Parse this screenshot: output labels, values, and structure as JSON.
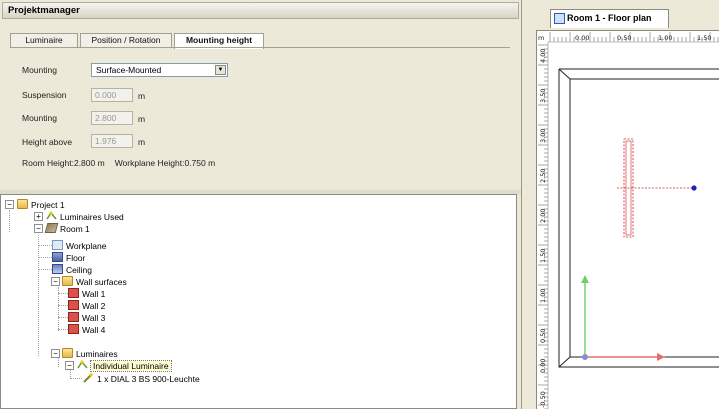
{
  "project_manager": {
    "title": "Projektmanager",
    "tabs": [
      {
        "label": "Luminaire"
      },
      {
        "label": "Position / Rotation"
      },
      {
        "label": "Mounting height"
      }
    ],
    "fields": {
      "mounting_label": "Mounting",
      "mounting_value": "Surface-Mounted",
      "suspension_label": "Suspension",
      "suspension_value": "0.000",
      "mounting2_label": "Mounting",
      "mounting2_value": "2.800",
      "height_above_label": "Height above",
      "height_above_value": "1.976",
      "unit": "m",
      "room_height": "Room Height:2.800 m",
      "workplane_height": "Workplane Height:0.750 m"
    }
  },
  "tree": {
    "project": "Project 1",
    "luminaires_used": "Luminaires Used",
    "room": "Room 1",
    "workplane": "Workplane",
    "floor": "Floor",
    "ceiling": "Ceiling",
    "wall_surfaces": "Wall surfaces",
    "walls": [
      "Wall 1",
      "Wall 2",
      "Wall 3",
      "Wall 4"
    ],
    "luminaires": "Luminaires",
    "individual_luminaire": "Individual Luminaire",
    "luminaire_item": "1 x DIAL 3 BS 900-Leuchte",
    "expanders": {
      "collapsed": "+",
      "expanded": "−"
    }
  },
  "floor_plan": {
    "tab_title": "Room 1 - Floor plan",
    "unit": "m",
    "x_ticks": [
      "0.00",
      "0.50",
      "1.00",
      "1.50"
    ],
    "y_ticks": [
      "4.00",
      "3.50",
      "3.00",
      "2.50",
      "2.00",
      "1.50",
      "1.00",
      "0.50",
      "0.00",
      "-0.50"
    ],
    "colors": {
      "luminaire": "#cc2222",
      "aim": "#2222bb",
      "x_axis": "#e07070",
      "y_axis": "#6ccf6c"
    }
  }
}
